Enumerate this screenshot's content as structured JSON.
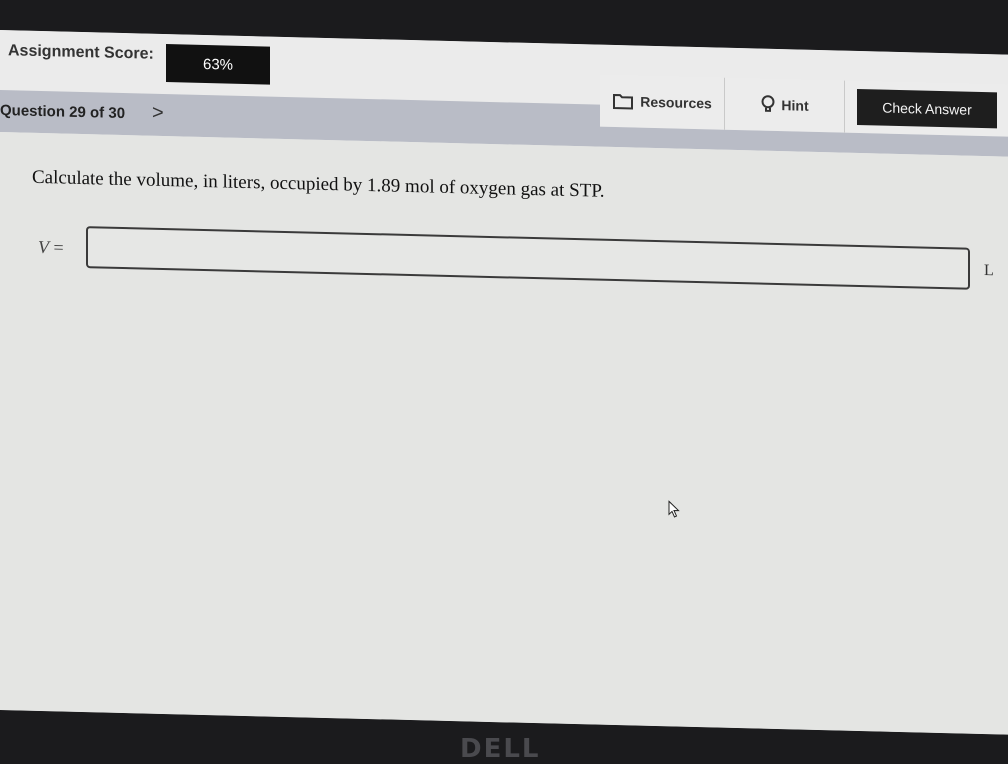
{
  "header": {
    "score_label": "Assignment Score:",
    "score_value": "63%",
    "tools": {
      "resources_label": "Resources",
      "resources_icon": "folder-icon",
      "hint_label": "Hint",
      "hint_icon": "lightbulb-icon",
      "check_label": "Check Answer"
    }
  },
  "question_nav": {
    "label": "Question 29 of 30",
    "next_symbol": ">"
  },
  "question": {
    "text": "Calculate the volume, in liters, occupied by 1.89 mol of oxygen gas at STP.",
    "variable": "V",
    "equals": "=",
    "answer_value": "",
    "unit": "L"
  },
  "device": {
    "logo": "DELL"
  },
  "colors": {
    "score_box": "#111111",
    "check_button": "#1e1e1e",
    "question_bar": "#b9bcc6"
  }
}
